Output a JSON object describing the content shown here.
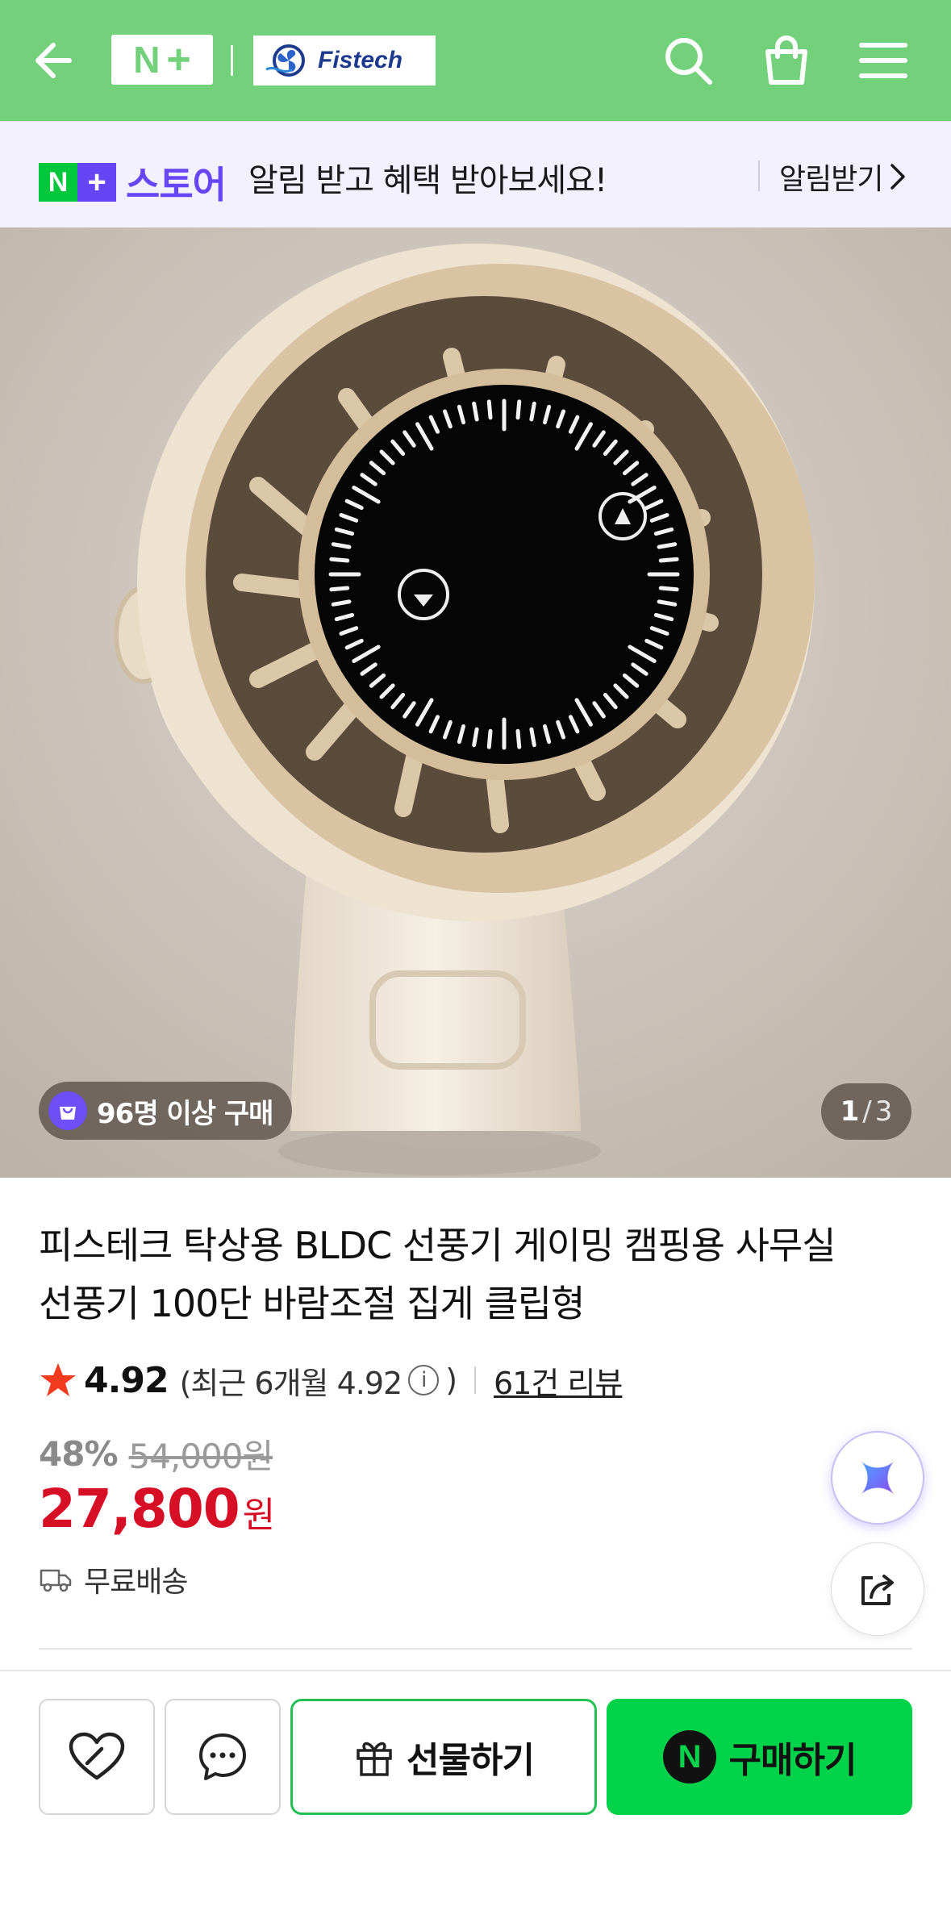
{
  "header": {
    "nplus_n": "N",
    "nplus_plus": "+",
    "brand_name": "Fistech",
    "icons": [
      "back-arrow-icon",
      "search-icon",
      "shopping-bag-icon",
      "menu-icon"
    ],
    "color": "#73d07b"
  },
  "banner": {
    "badge_n": "N",
    "badge_plus": "+",
    "store_word": "스토어",
    "message": "알림 받고 혜택 받아보세요!",
    "cta": "알림받기",
    "accent": "#6645f5"
  },
  "gallery": {
    "purchase_badge": "96명 이상 구매",
    "page_current": "1",
    "page_sep": "/",
    "page_total": "3"
  },
  "product": {
    "title": "피스테크 탁상용 BLDC 선풍기 게이밍 캠핑용 사무실 선풍기 100단 바람조절 집게 클립형",
    "rating": "4.92",
    "recent_rating": "(최근 6개월 4.92",
    "recent_rating_close": ")",
    "info_glyph": "i",
    "reviews": "61건 리뷰",
    "discount": "48%",
    "original_price": "54,000원",
    "price": "27,800",
    "currency": "원",
    "shipping": "무료배송",
    "price_color": "#d70f26"
  },
  "actions": {
    "gift_label": "선물하기",
    "buy_label": "구매하기",
    "buy_badge": "N",
    "buy_color": "#03d34a"
  }
}
